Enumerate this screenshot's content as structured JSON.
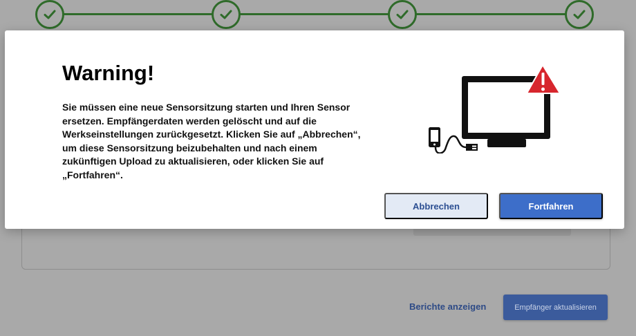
{
  "stepper": {
    "steps": [
      {
        "status": "complete",
        "icon": "checkmark-icon"
      },
      {
        "status": "complete",
        "icon": "checkmark-icon"
      },
      {
        "status": "complete",
        "icon": "checkmark-icon"
      },
      {
        "status": "complete",
        "icon": "checkmark-icon"
      }
    ],
    "color": "#2f6b2a"
  },
  "background": {
    "reports_link": "Berichte anzeigen",
    "update_button": "Empfänger aktualisieren"
  },
  "modal": {
    "title": "Warning!",
    "body": "Sie müssen eine neue Sensorsitzung starten und Ihren Sensor ersetzen. Empfängerdaten werden gelöscht und auf die Werkseinstellungen zurückgesetzt. Klicken Sie auf „Abbrechen“, um diese Sensorsitzung beizubehalten und nach einem zukünftigen Upload zu aktualisieren, oder klicken Sie auf „Fortfahren“.",
    "illustration": {
      "icons": [
        "monitor-icon",
        "warning-triangle-icon",
        "phone-icon",
        "usb-cable-icon"
      ],
      "warning_color": "#d7262d"
    },
    "cancel_label": "Abbrechen",
    "continue_label": "Fortfahren",
    "accent_color": "#3d6ec9"
  }
}
